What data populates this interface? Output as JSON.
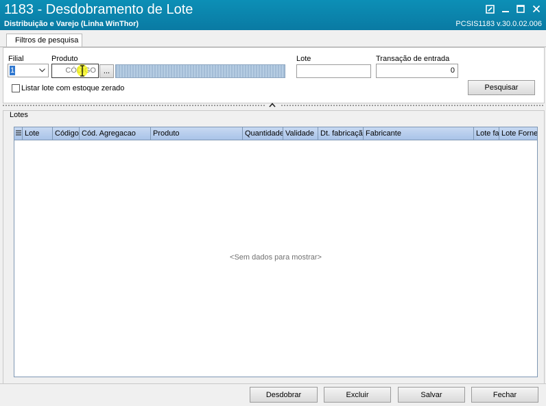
{
  "window": {
    "title": "1183 - Desdobramento de Lote",
    "subtitle": "Distribuição e Varejo (Linha WinThor)",
    "version": "PCSIS1183  v.30.0.02.006"
  },
  "tabs": [
    {
      "label": "Filtros de pesquisa"
    }
  ],
  "filters": {
    "filial_label": "Filial",
    "filial_value": "1",
    "produto_label": "Produto",
    "produto_code_value": "CÓDIGO",
    "ellipsis_label": "...",
    "lote_label": "Lote",
    "lote_value": "",
    "transacao_label": "Transação de entrada",
    "transacao_value": "0",
    "checkbox_label": "Listar lote com estoque zerado",
    "checkbox_checked": false,
    "search_button": "Pesquisar"
  },
  "lotes": {
    "group_label": "Lotes",
    "columns": [
      "Lote",
      "Código",
      "Cód. Agregacao",
      "Produto",
      "Quantidade",
      "Validade",
      "Dt. fabricação",
      "Fabricante",
      "Lote fa",
      "Lote Forne"
    ],
    "empty_text": "<Sem dados para mostrar>"
  },
  "footer": {
    "desdobrar": "Desdobrar",
    "excluir": "Excluir",
    "salvar": "Salvar",
    "fechar": "Fechar"
  },
  "colors": {
    "titlebar": "#0a84ad",
    "grid_header": "#b8cfee",
    "cursor_highlight": "#f5f500"
  }
}
